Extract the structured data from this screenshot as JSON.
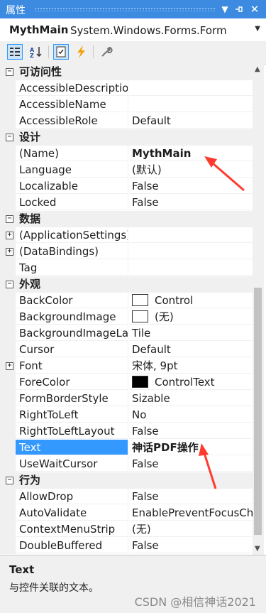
{
  "window": {
    "title": "属性",
    "pin_icon": "pin-icon",
    "dropdown_icon": "chevron-down-icon",
    "close_icon": "close-icon"
  },
  "object_selector": {
    "name": "MythMain",
    "type": "System.Windows.Forms.Form"
  },
  "toolbar": {
    "buttons": [
      "categorized-icon",
      "alphabetical-icon",
      "properties-icon",
      "events-icon",
      "property-pages-icon"
    ]
  },
  "grid": {
    "rows": [
      {
        "kind": "cat",
        "label": "可访问性"
      },
      {
        "kind": "prop",
        "name": "AccessibleDescription",
        "value": ""
      },
      {
        "kind": "prop",
        "name": "AccessibleName",
        "value": ""
      },
      {
        "kind": "prop",
        "name": "AccessibleRole",
        "value": "Default"
      },
      {
        "kind": "cat",
        "label": "设计"
      },
      {
        "kind": "prop",
        "name": "(Name)",
        "value": "MythMain"
      },
      {
        "kind": "prop",
        "name": "Language",
        "value": "(默认)"
      },
      {
        "kind": "prop",
        "name": "Localizable",
        "value": "False"
      },
      {
        "kind": "prop",
        "name": "Locked",
        "value": "False"
      },
      {
        "kind": "cat",
        "label": "数据"
      },
      {
        "kind": "prop",
        "name": "(ApplicationSettings)",
        "value": ""
      },
      {
        "kind": "prop",
        "name": "(DataBindings)",
        "value": ""
      },
      {
        "kind": "prop",
        "name": "Tag",
        "value": ""
      },
      {
        "kind": "cat",
        "label": "外观"
      },
      {
        "kind": "prop",
        "name": "BackColor",
        "value": "Control"
      },
      {
        "kind": "prop",
        "name": "BackgroundImage",
        "value": "(无)"
      },
      {
        "kind": "prop",
        "name": "BackgroundImageLayout",
        "value": "Tile"
      },
      {
        "kind": "prop",
        "name": "Cursor",
        "value": "Default"
      },
      {
        "kind": "prop",
        "name": "Font",
        "value": "宋体, 9pt"
      },
      {
        "kind": "prop",
        "name": "ForeColor",
        "value": "ControlText"
      },
      {
        "kind": "prop",
        "name": "FormBorderStyle",
        "value": "Sizable"
      },
      {
        "kind": "prop",
        "name": "RightToLeft",
        "value": "No"
      },
      {
        "kind": "prop",
        "name": "RightToLeftLayout",
        "value": "False"
      },
      {
        "kind": "prop",
        "name": "Text",
        "value": "神话PDF操作"
      },
      {
        "kind": "prop",
        "name": "UseWaitCursor",
        "value": "False"
      },
      {
        "kind": "cat",
        "label": "行为"
      },
      {
        "kind": "prop",
        "name": "AllowDrop",
        "value": "False"
      },
      {
        "kind": "prop",
        "name": "AutoValidate",
        "value": "EnablePreventFocusChange"
      },
      {
        "kind": "prop",
        "name": "ContextMenuStrip",
        "value": "(无)"
      },
      {
        "kind": "prop",
        "name": "DoubleBuffered",
        "value": "False"
      }
    ]
  },
  "description": {
    "title": "Text",
    "text": "与控件关联的文本。"
  },
  "watermark": "CSDN @相信神话2021",
  "colors": {
    "selection": "#3399ff",
    "title_bar": "#3c8be0",
    "annotation_arrow": "#ff3b30"
  }
}
